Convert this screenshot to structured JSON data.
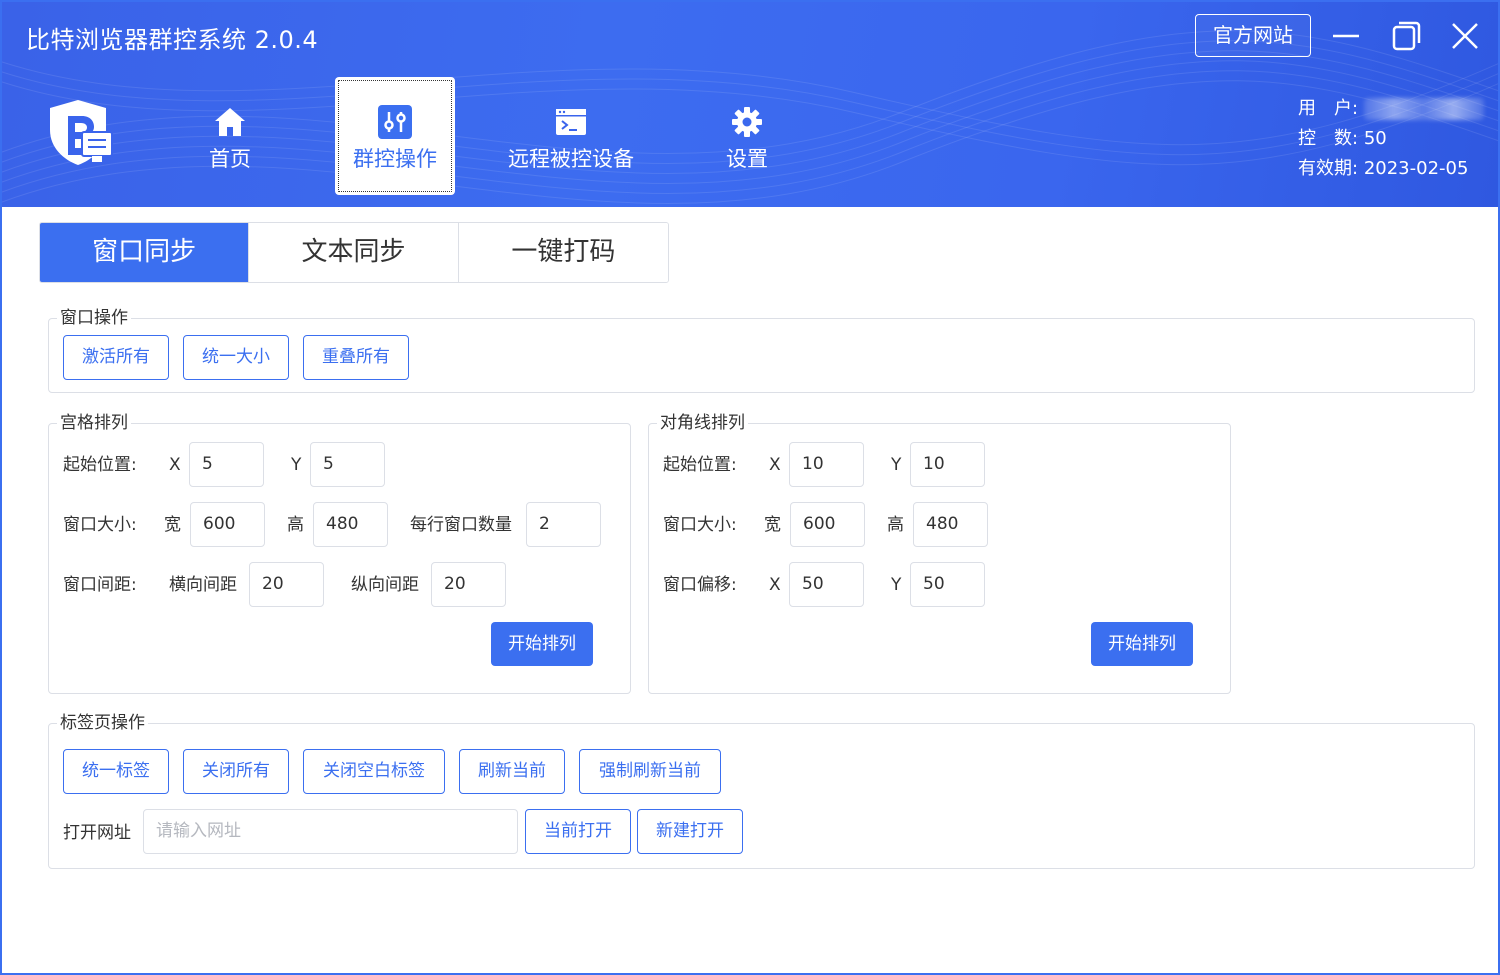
{
  "window": {
    "title": "比特浏览器群控系统 2.0.4",
    "site_button": "官方网站"
  },
  "nav": {
    "home": "首页",
    "group_control": "群控操作",
    "remote_devices": "远程被控设备",
    "settings": "设置"
  },
  "user": {
    "user_label": "用　户:",
    "count_label": "控　数:",
    "count_value": "50",
    "expiry_label": "有效期:",
    "expiry_value": "2023-02-05"
  },
  "tabs": [
    "窗口同步",
    "文本同步",
    "一键打码"
  ],
  "window_ops": {
    "title": "窗口操作",
    "buttons": [
      "激活所有",
      "统一大小",
      "重叠所有"
    ]
  },
  "grid": {
    "title": "宫格排列",
    "start_label": "起始位置:",
    "x_label": "X",
    "y_label": "Y",
    "x_value": "5",
    "y_value": "5",
    "size_label": "窗口大小:",
    "width_label": "宽",
    "height_label": "高",
    "width_value": "600",
    "height_value": "480",
    "per_row_label": "每行窗口数量",
    "per_row_value": "2",
    "gap_label": "窗口间距:",
    "h_gap_label": "横向间距",
    "h_gap_value": "20",
    "v_gap_label": "纵向间距",
    "v_gap_value": "20",
    "start_button": "开始排列"
  },
  "diagonal": {
    "title": "对角线排列",
    "start_label": "起始位置:",
    "x_label": "X",
    "y_label": "Y",
    "x_value": "10",
    "y_value": "10",
    "size_label": "窗口大小:",
    "width_label": "宽",
    "height_label": "高",
    "width_value": "600",
    "height_value": "480",
    "offset_label": "窗口偏移:",
    "offset_x_value": "50",
    "offset_y_value": "50",
    "start_button": "开始排列"
  },
  "tab_ops": {
    "title": "标签页操作",
    "buttons": [
      "统一标签",
      "关闭所有",
      "关闭空白标签",
      "刷新当前",
      "强制刷新当前"
    ],
    "url_label": "打开网址",
    "url_placeholder": "请输入网址",
    "open_current": "当前打开",
    "open_new": "新建打开"
  },
  "colors": {
    "primary": "#3b6ff0",
    "header_bg": "#3a64ec",
    "border": "#dcdfe6",
    "text": "#333333"
  },
  "icons": {
    "home": "home-icon",
    "group_control": "sliders-icon",
    "remote": "terminal-icon",
    "settings": "gear-icon",
    "logo": "bit-browser-logo"
  }
}
